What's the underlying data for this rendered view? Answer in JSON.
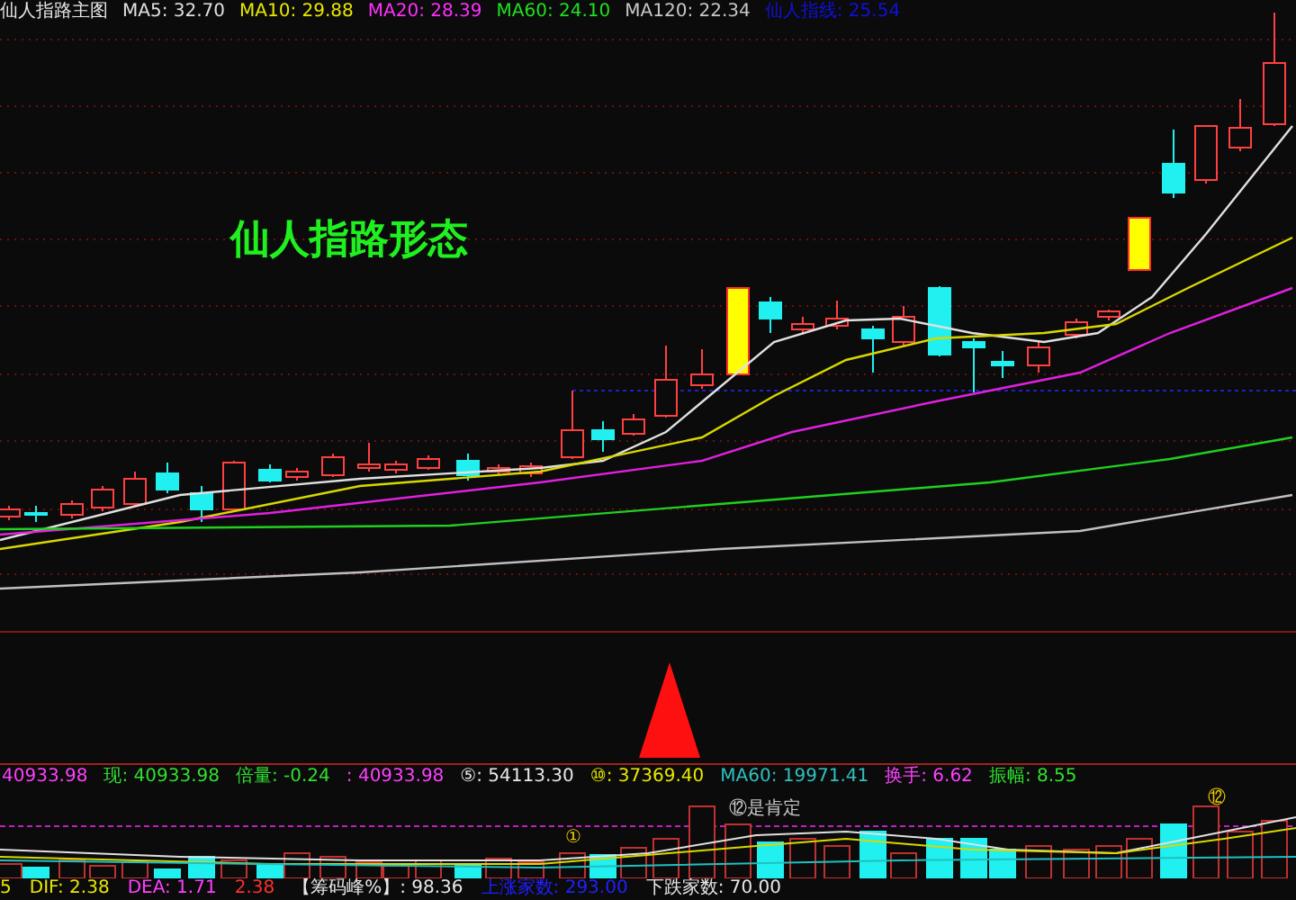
{
  "main_chart": {
    "title": "仙人指路主图",
    "indicators": [
      {
        "label": "MA5: 32.70",
        "color": "#e0e0e0"
      },
      {
        "label": "MA10: 29.88",
        "color": "#e8e800"
      },
      {
        "label": "MA20: 28.39",
        "color": "#ff30ff"
      },
      {
        "label": "MA60: 24.10",
        "color": "#20e020"
      },
      {
        "label": "MA120: 22.34",
        "color": "#c8c8c8"
      },
      {
        "label": "仙人指线: 25.54",
        "color": "#1010e0"
      }
    ],
    "pattern_label": "仙人指路形态"
  },
  "info_bar": {
    "items": [
      {
        "text": "40933.98",
        "color": "#ff40ff"
      },
      {
        "text": "现: 40933.98",
        "color": "#30e030"
      },
      {
        "text": "倍量: -0.24",
        "color": "#30e030"
      },
      {
        "text": ": 40933.98",
        "color": "#ff40ff"
      },
      {
        "text": "⑤: 54113.30",
        "color": "#e8e8e8"
      },
      {
        "text": "⑩: 37369.40",
        "color": "#e8e800"
      },
      {
        "text": "MA60: 19971.41",
        "color": "#30c0c0"
      },
      {
        "text": "换手: 6.62",
        "color": "#ff40ff"
      },
      {
        "text": "振幅: 8.55",
        "color": "#30e030"
      }
    ]
  },
  "volume_panel": {
    "markers": [
      {
        "text": "①",
        "color": "#e8c800"
      },
      {
        "text": "⑫是肯定",
        "color": "#c8c8c8"
      },
      {
        "text": "⑫",
        "color": "#e8c800"
      }
    ]
  },
  "bottom_bar": {
    "items": [
      {
        "text": "5",
        "color": "#e8e800"
      },
      {
        "text": "DIF: 2.38",
        "color": "#e8e800"
      },
      {
        "text": "DEA: 1.71",
        "color": "#ff40ff"
      },
      {
        "text": "2.38",
        "color": "#ff3030"
      },
      {
        "text": "【筹码峰%】: 98.36",
        "color": "#e8e8e8"
      },
      {
        "text": "上涨家数: 293.00",
        "color": "#2020ff"
      },
      {
        "text": "下跌家数: 70.00",
        "color": "#e8e8e8"
      }
    ]
  }
}
